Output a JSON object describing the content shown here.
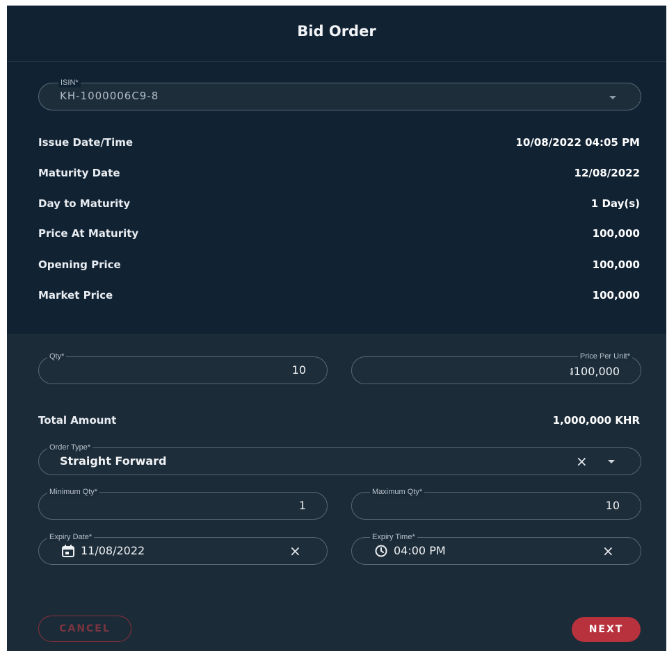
{
  "dialog": {
    "title": "Bid Order"
  },
  "isin": {
    "label": "ISIN*",
    "value": "KH-1000006C9-8"
  },
  "details": [
    {
      "label": "Issue Date/Time",
      "value": "10/08/2022 04:05 PM"
    },
    {
      "label": "Maturity Date",
      "value": "12/08/2022"
    },
    {
      "label": "Day to Maturity",
      "value": "1 Day(s)"
    },
    {
      "label": "Price At Maturity",
      "value": "100,000"
    },
    {
      "label": "Opening Price",
      "value": "100,000"
    },
    {
      "label": "Market Price",
      "value": "100,000"
    }
  ],
  "qty": {
    "label": "Qty*",
    "value": "10"
  },
  "price_per_unit": {
    "label": "Price Per Unit*",
    "value": "៛100,000"
  },
  "total": {
    "label": "Total Amount",
    "value": "1,000,000 KHR"
  },
  "order_type": {
    "label": "Order Type*",
    "value": "Straight Forward"
  },
  "min_qty": {
    "label": "Minimum Qty*",
    "value": "1"
  },
  "max_qty": {
    "label": "Maximum Qty*",
    "value": "10"
  },
  "expiry_date": {
    "label": "Expiry Date*",
    "value": "11/08/2022"
  },
  "expiry_time": {
    "label": "Expiry Time*",
    "value": "04:00 PM"
  },
  "buttons": {
    "cancel": "CANCEL",
    "next": "NEXT"
  },
  "icons": {
    "clear": "×",
    "calendar": "calendar-icon",
    "clock": "clock-icon",
    "dropdown": "caret-down-icon"
  },
  "colors": {
    "background": "#1b2b38",
    "header": "#112233",
    "accent": "#b8323e",
    "text": "#ffffff"
  }
}
